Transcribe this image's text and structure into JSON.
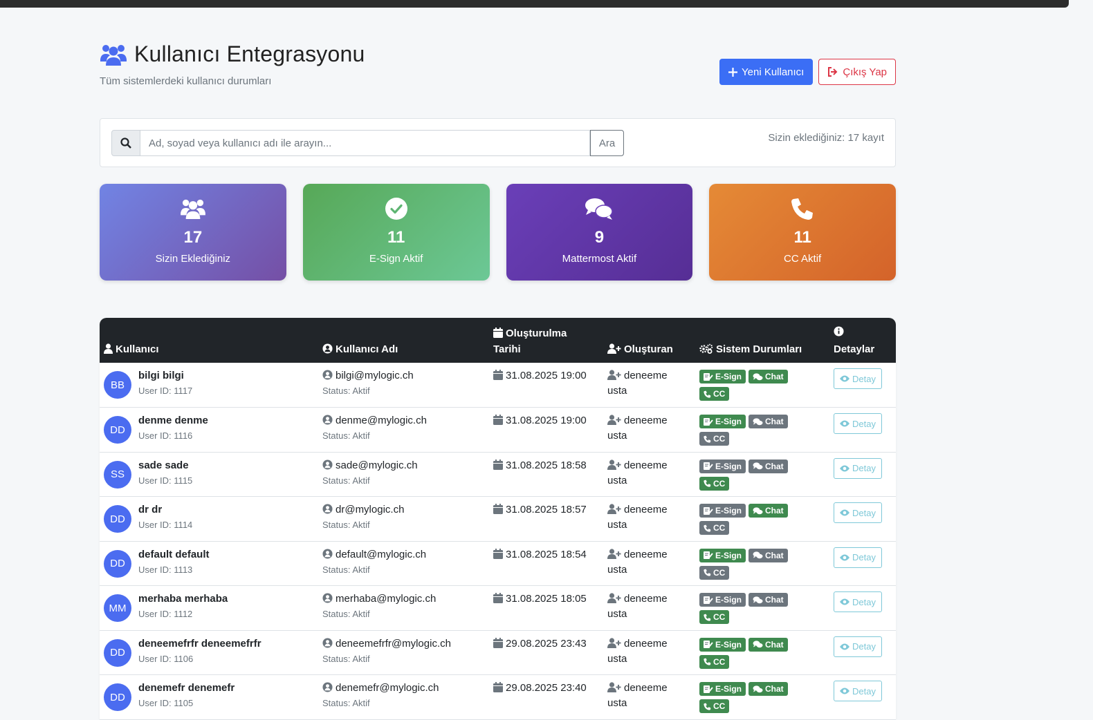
{
  "header": {
    "title": "Kullanıcı Entegrasyonu",
    "subtitle": "Tüm sistemlerdeki kullanıcı durumları",
    "new_user_label": "Yeni Kullanıcı",
    "logout_label": "Çıkış Yap"
  },
  "search": {
    "placeholder": "Ad, soyad veya kullanıcı adı ile arayın...",
    "button_label": "Ara",
    "record_count": "Sizin eklediğiniz: 17 kayıt"
  },
  "stats": [
    {
      "value": "17",
      "label": "Sizin Eklediğiniz",
      "icon": "users-icon"
    },
    {
      "value": "11",
      "label": "E-Sign Aktif",
      "icon": "check-circle-icon"
    },
    {
      "value": "9",
      "label": "Mattermost Aktif",
      "icon": "chat-icon"
    },
    {
      "value": "11",
      "label": "CC Aktif",
      "icon": "phone-icon"
    }
  ],
  "table": {
    "headers": {
      "user": "Kullanıcı",
      "username": "Kullanıcı Adı",
      "created_line1": "Oluşturulma",
      "created_line2": "Tarihi",
      "creator": "Oluşturan",
      "status": "Sistem Durumları",
      "details": "Detaylar"
    },
    "badge_labels": {
      "esign": "E-Sign",
      "chat": "Chat",
      "cc": "CC"
    },
    "detail_label": "Detay",
    "colors": {
      "active": "#3f8a4f",
      "inactive": "#6c757d"
    },
    "rows": [
      {
        "initials": "BB",
        "name": "bilgi bilgi",
        "user_id": "User ID: 1117",
        "username": "bilgi@mylogic.ch",
        "status": "Status: Aktif",
        "created": "31.08.2025 19:00",
        "creator_line1": "deneeme",
        "creator_line2": "usta",
        "esign": true,
        "chat": true,
        "cc": true
      },
      {
        "initials": "DD",
        "name": "denme denme",
        "user_id": "User ID: 1116",
        "username": "denme@mylogic.ch",
        "status": "Status: Aktif",
        "created": "31.08.2025 19:00",
        "creator_line1": "deneeme",
        "creator_line2": "usta",
        "esign": true,
        "chat": false,
        "cc": false
      },
      {
        "initials": "SS",
        "name": "sade sade",
        "user_id": "User ID: 1115",
        "username": "sade@mylogic.ch",
        "status": "Status: Aktif",
        "created": "31.08.2025 18:58",
        "creator_line1": "deneeme",
        "creator_line2": "usta",
        "esign": false,
        "chat": false,
        "cc": true
      },
      {
        "initials": "DD",
        "name": "dr dr",
        "user_id": "User ID: 1114",
        "username": "dr@mylogic.ch",
        "status": "Status: Aktif",
        "created": "31.08.2025 18:57",
        "creator_line1": "deneeme",
        "creator_line2": "usta",
        "esign": false,
        "chat": true,
        "cc": false
      },
      {
        "initials": "DD",
        "name": "default default",
        "user_id": "User ID: 1113",
        "username": "default@mylogic.ch",
        "status": "Status: Aktif",
        "created": "31.08.2025 18:54",
        "creator_line1": "deneeme",
        "creator_line2": "usta",
        "esign": true,
        "chat": false,
        "cc": false
      },
      {
        "initials": "MM",
        "name": "merhaba merhaba",
        "user_id": "User ID: 1112",
        "username": "merhaba@mylogic.ch",
        "status": "Status: Aktif",
        "created": "31.08.2025 18:05",
        "creator_line1": "deneeme",
        "creator_line2": "usta",
        "esign": false,
        "chat": false,
        "cc": true
      },
      {
        "initials": "DD",
        "name": "deneemefrfr deneemefrfr",
        "user_id": "User ID: 1106",
        "username": "deneemefrfr@mylogic.ch",
        "status": "Status: Aktif",
        "created": "29.08.2025 23:43",
        "creator_line1": "deneeme",
        "creator_line2": "usta",
        "esign": true,
        "chat": true,
        "cc": true
      },
      {
        "initials": "DD",
        "name": "denemefr denemefr",
        "user_id": "User ID: 1105",
        "username": "denemefr@mylogic.ch",
        "status": "Status: Aktif",
        "created": "29.08.2025 23:40",
        "creator_line1": "deneeme",
        "creator_line2": "usta",
        "esign": true,
        "chat": true,
        "cc": true
      }
    ]
  }
}
